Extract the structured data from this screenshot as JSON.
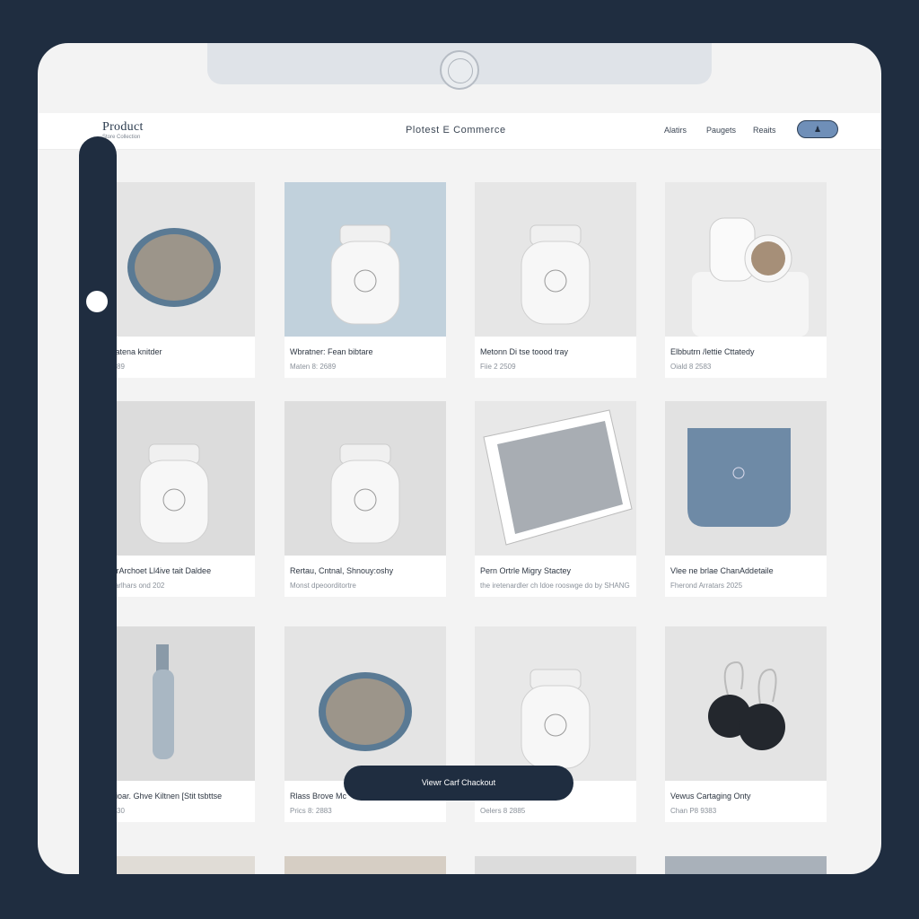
{
  "header": {
    "logo_title": "Product",
    "logo_sub": "Store Collection",
    "store_title": "Plotest E Commerce",
    "nav": [
      "Alatirs",
      "Paugets",
      "Reaits"
    ],
    "nav_button": "♟"
  },
  "products": [
    {
      "name": "an Patena knitder",
      "sub": "an 2589",
      "bg": "#e4e4e4",
      "icon": "bowl-icon"
    },
    {
      "name": "Wbratner: Fean bibtare",
      "sub": "Maten 8: 2689",
      "bg": "#c1d1dc",
      "icon": "jar-icon"
    },
    {
      "name": "Metonn Di tse toood tray",
      "sub": "Fiie 2 2509",
      "bg": "#e6e6e6",
      "icon": "jar-icon"
    },
    {
      "name": "Elbbutrn /lettie Cttatedy",
      "sub": "Oiald 8 2583",
      "bg": "#e9e9e9",
      "icon": "cup-icon"
    },
    {
      "name": "an OrArchoet Ll4ive tait Daldee",
      "sub": "an Marlhars ond 202",
      "bg": "#dcdcdc",
      "icon": "jar-icon"
    },
    {
      "name": "Rertau, Cntnal, Shnouy:oshy",
      "sub": "Monst dpeoorditortre",
      "bg": "#dedede",
      "icon": "jar-icon"
    },
    {
      "name": "Pern Ortrle Migry Stactey",
      "sub": "the iretenardler ch ldoe rooswge do by SHANG",
      "bg": "#e8e8e8",
      "icon": "book-icon"
    },
    {
      "name": "Vlee ne brlae ChanAddetaile",
      "sub": "Fherond Arratars 2025",
      "bg": "#e2e2e2",
      "icon": "bag-icon"
    },
    {
      "name": "an Rioar. Ghve Kiltnen [Stit tsbttse",
      "sub": "an 2530",
      "bg": "#dbdbdb",
      "icon": "bottle-icon"
    },
    {
      "name": "Rlass Brove Mc",
      "sub": "Prics 8: 2883",
      "bg": "#e4e4e4",
      "icon": "bowl-icon"
    },
    {
      "name": "",
      "sub": "Oelers 8 2885",
      "bg": "#e8e8e8",
      "icon": "jar-icon"
    },
    {
      "name": "Vewus Cartaging Onty",
      "sub": "Chan P8 9383",
      "bg": "#e4e4e4",
      "icon": "ornament-icon"
    }
  ],
  "checkout_label": "Viewr Carf Chackout",
  "colors": {
    "navy": "#1f2d40",
    "accent": "#6f8fb8",
    "frame": "#f3f3f3"
  }
}
